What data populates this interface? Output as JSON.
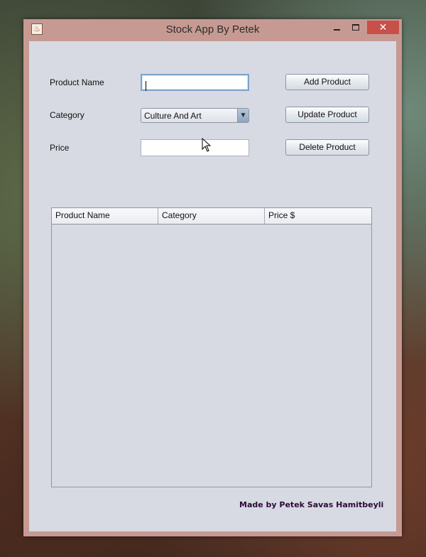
{
  "window": {
    "title": "Stock App By Petek",
    "close_symbol": "✕",
    "app_icon_glyph": "♨"
  },
  "form": {
    "product_name_label": "Product Name",
    "product_name_value": "",
    "category_label": "Category",
    "category_value": "Culture And Art",
    "category_arrow": "▼",
    "price_label": "Price",
    "price_value": ""
  },
  "buttons": {
    "add": "Add Product",
    "update": "Update Product",
    "delete": "Delete Product"
  },
  "table": {
    "columns": [
      "Product Name",
      "Category",
      "Price $"
    ],
    "rows": []
  },
  "footer": {
    "credit": "Made by Petek Savas Hamitbeyli"
  },
  "colors": {
    "title_bar": "#c69a92",
    "client_bg": "#d7dae2",
    "close_button": "#c7504b",
    "credit_text": "#2b0b38"
  },
  "icons": [
    "app-coffee-icon",
    "minimize-icon",
    "maximize-icon",
    "close-icon",
    "dropdown-arrow-icon",
    "mouse-cursor-icon"
  ]
}
